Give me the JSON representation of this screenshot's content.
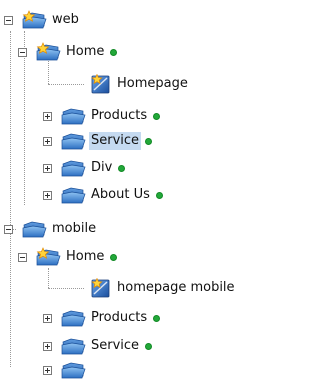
{
  "tree": {
    "web": {
      "label": "web"
    },
    "web_home": {
      "label": "Home"
    },
    "web_homepage": {
      "label": "Homepage"
    },
    "web_products": {
      "label": "Products"
    },
    "web_service": {
      "label": "Service"
    },
    "web_div": {
      "label": "Div"
    },
    "web_about": {
      "label": "About Us"
    },
    "mobile": {
      "label": "mobile"
    },
    "mobile_home": {
      "label": "Home"
    },
    "mobile_homepage": {
      "label": "homepage mobile"
    },
    "mobile_products": {
      "label": "Products"
    },
    "mobile_service": {
      "label": "Service"
    }
  },
  "colors": {
    "selection": "#c5daf0",
    "status_dot": "#22a83a"
  },
  "icons": {
    "folder_star": "folder-star-icon",
    "folder": "folder-icon",
    "page_star": "page-star-icon"
  }
}
